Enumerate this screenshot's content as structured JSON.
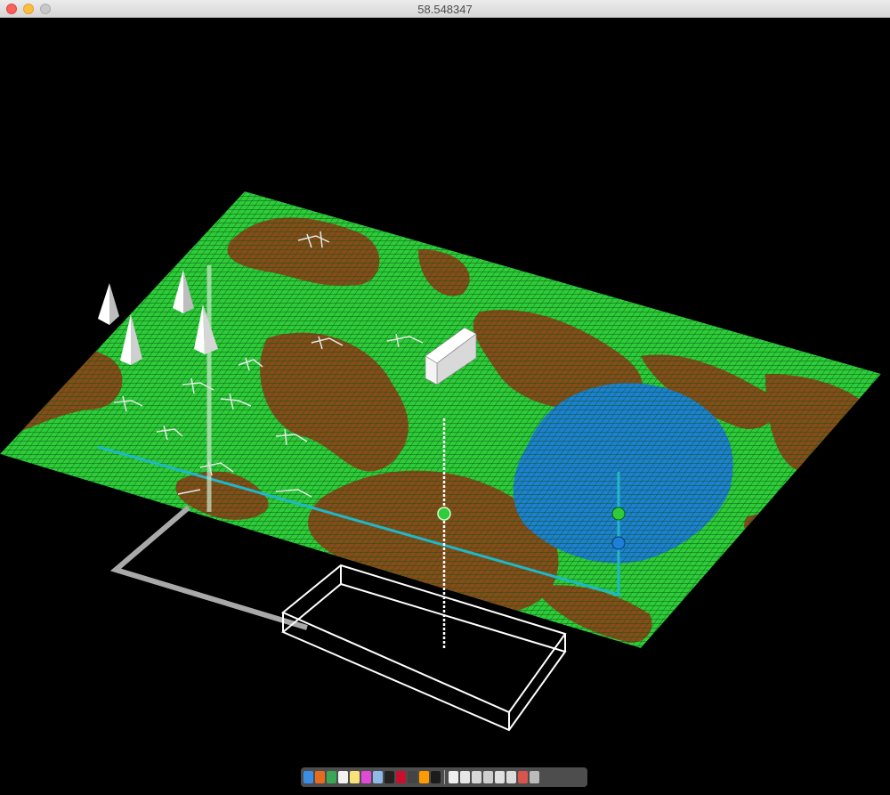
{
  "window": {
    "title": "58.548347"
  },
  "scene": {
    "colors": {
      "grass": "#2ecc3a",
      "dirt": "#8a4a1a",
      "water": "#1e7fd6",
      "grid_line": "#0a5a10",
      "background": "#000000"
    },
    "spikes": 5,
    "skeletons": 10,
    "obstacle": "block",
    "markers": [
      "green-sphere",
      "green-sphere",
      "blue-sphere"
    ]
  },
  "dock": {
    "icons": [
      {
        "name": "finder-icon",
        "color": "#3b8ee8"
      },
      {
        "name": "firefox-icon",
        "color": "#e66b1e"
      },
      {
        "name": "chrome-icon",
        "color": "#3aa757"
      },
      {
        "name": "calendar-icon",
        "color": "#f2f2f2"
      },
      {
        "name": "notes-icon",
        "color": "#f7e27a"
      },
      {
        "name": "itunes-icon",
        "color": "#e04ad6"
      },
      {
        "name": "preview-icon",
        "color": "#8fb9e6"
      },
      {
        "name": "terminal-icon",
        "color": "#222222"
      },
      {
        "name": "acrobat-icon",
        "color": "#c8102e"
      },
      {
        "name": "inkscape-icon",
        "color": "#444444"
      },
      {
        "name": "illustrator-icon",
        "color": "#ff9a00"
      },
      {
        "name": "quicktime-icon",
        "color": "#1c1c1c"
      },
      {
        "name": "separator",
        "color": ""
      },
      {
        "name": "document-icon",
        "color": "#f0f0f0"
      },
      {
        "name": "text-icon",
        "color": "#e6e6e6"
      },
      {
        "name": "window-icon",
        "color": "#d8d8d8"
      },
      {
        "name": "screenshot-icon",
        "color": "#cfcfcf"
      },
      {
        "name": "window-icon",
        "color": "#e0e0e0"
      },
      {
        "name": "window-icon",
        "color": "#dcdcdc"
      },
      {
        "name": "pdf-icon",
        "color": "#d9534f"
      },
      {
        "name": "trash-icon",
        "color": "#bbbbbb"
      }
    ]
  }
}
